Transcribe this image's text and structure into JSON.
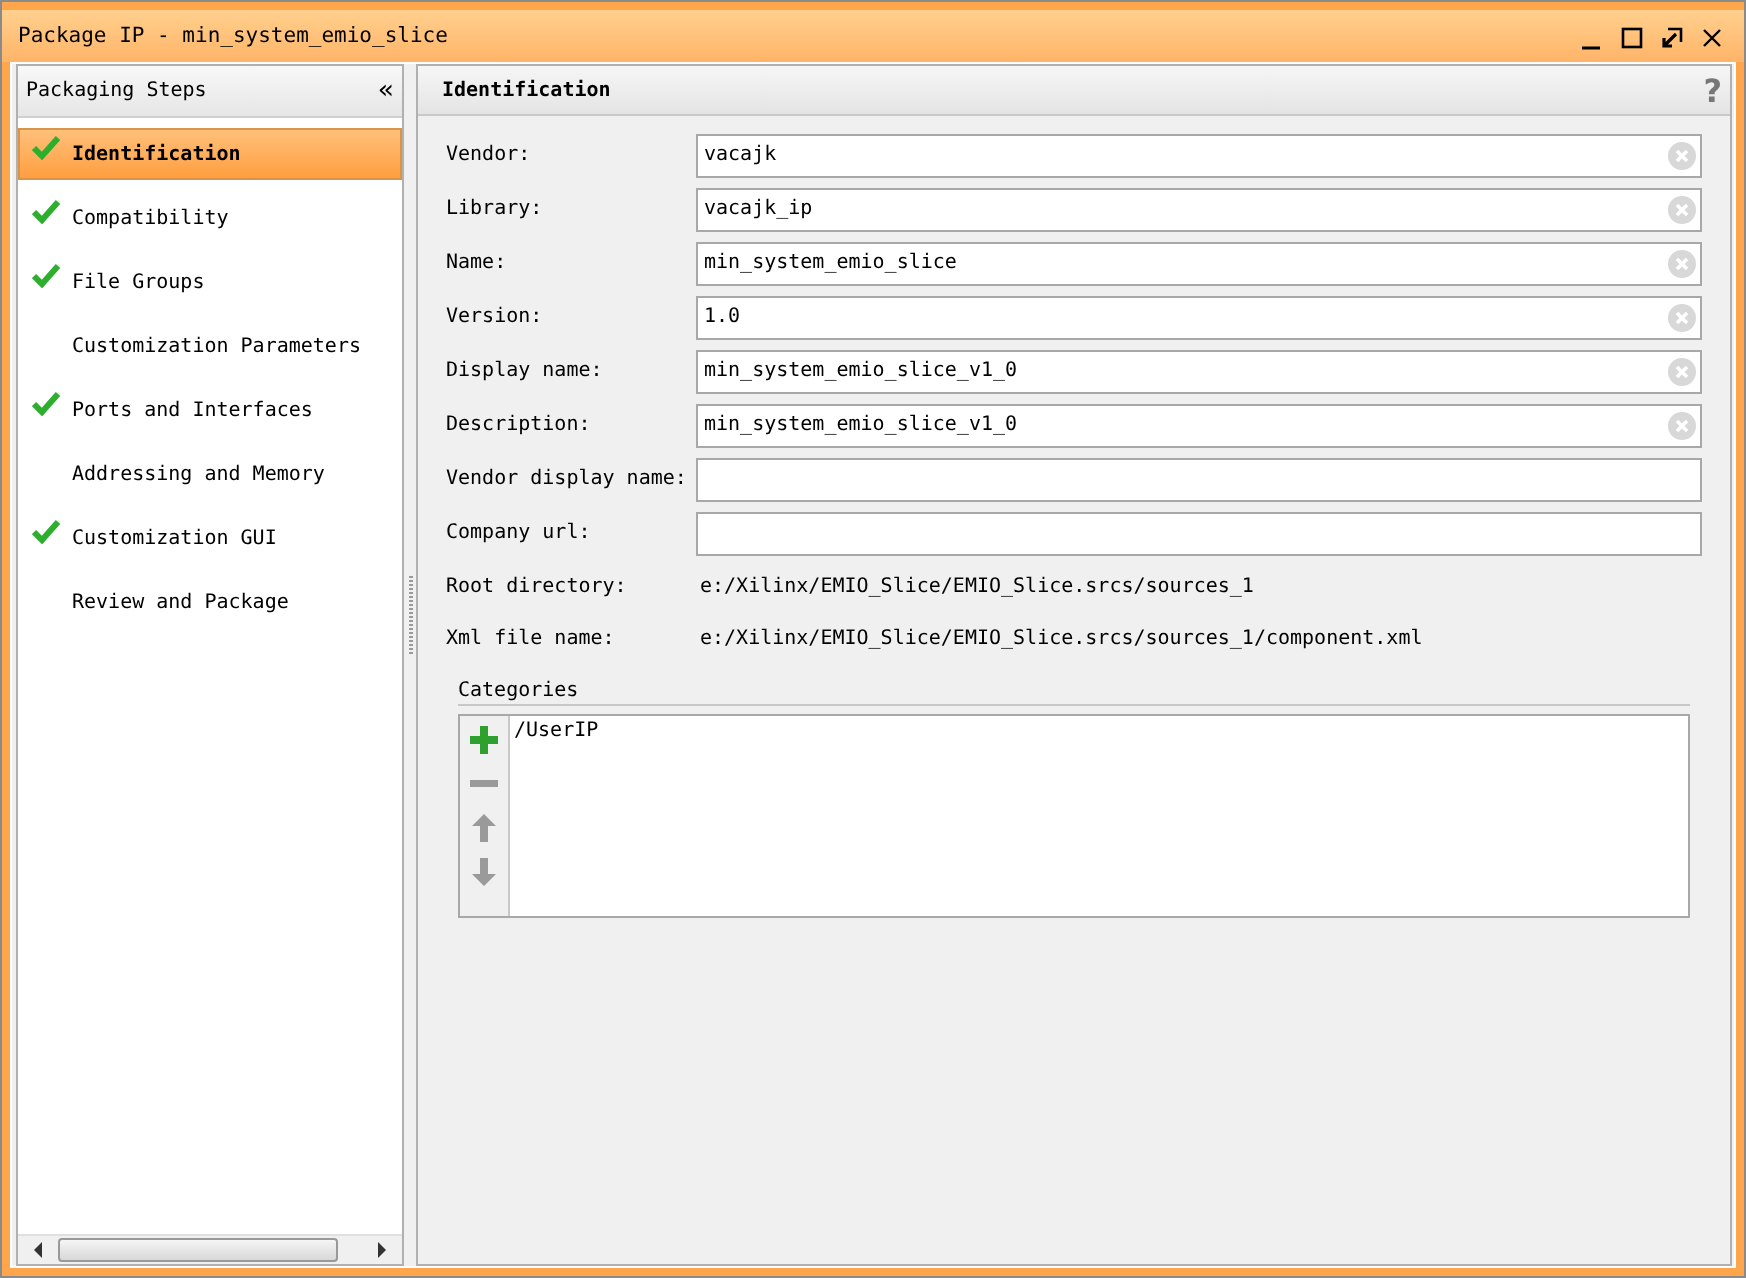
{
  "window": {
    "title": "Package IP - min_system_emio_slice"
  },
  "sidebar": {
    "title": "Packaging Steps",
    "collapse_glyph": "«",
    "steps": [
      {
        "label": "Identification",
        "checked": true,
        "selected": true
      },
      {
        "label": "Compatibility",
        "checked": true,
        "selected": false
      },
      {
        "label": "File Groups",
        "checked": true,
        "selected": false
      },
      {
        "label": "Customization Parameters",
        "checked": false,
        "selected": false
      },
      {
        "label": "Ports and Interfaces",
        "checked": true,
        "selected": false
      },
      {
        "label": "Addressing and Memory",
        "checked": false,
        "selected": false
      },
      {
        "label": "Customization GUI",
        "checked": true,
        "selected": false
      },
      {
        "label": "Review and Package",
        "checked": false,
        "selected": false
      }
    ]
  },
  "panel": {
    "title": "Identification",
    "help_glyph": "?",
    "fields": [
      {
        "kind": "input",
        "label": "Vendor:",
        "value": "vacajk"
      },
      {
        "kind": "input",
        "label": "Library:",
        "value": "vacajk_ip"
      },
      {
        "kind": "input",
        "label": "Name:",
        "value": "min_system_emio_slice"
      },
      {
        "kind": "input",
        "label": "Version:",
        "value": "1.0"
      },
      {
        "kind": "input",
        "label": "Display name:",
        "value": "min_system_emio_slice_v1_0"
      },
      {
        "kind": "input",
        "label": "Description:",
        "value": "min_system_emio_slice_v1_0"
      },
      {
        "kind": "input",
        "label": "Vendor display name:"
      },
      {
        "kind": "input",
        "label": "Company url:"
      },
      {
        "kind": "text",
        "label": "Root directory:",
        "value": "e:/Xilinx/EMIO_Slice/EMIO_Slice.srcs/sources_1"
      },
      {
        "kind": "text",
        "label": "Xml file name:",
        "value": "e:/Xilinx/EMIO_Slice/EMIO_Slice.srcs/sources_1/component.xml"
      }
    ],
    "categories": {
      "title": "Categories",
      "tools": [
        {
          "kind": "add",
          "disabled": false
        },
        {
          "kind": "remove",
          "disabled": true
        },
        {
          "kind": "up",
          "disabled": true
        },
        {
          "kind": "down",
          "disabled": true
        }
      ],
      "items": [
        "/UserIP"
      ]
    }
  }
}
